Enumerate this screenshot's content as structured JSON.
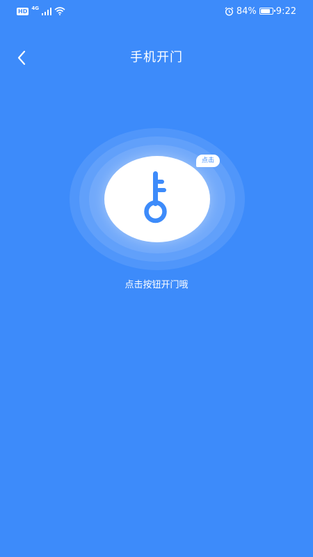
{
  "status_bar": {
    "hd": "HD",
    "network": "4G",
    "battery_percent": "84%",
    "battery_level": 0.84,
    "time": "9:22",
    "icons": {
      "signal": "signal-icon",
      "wifi": "wifi-icon",
      "alarm": "alarm-icon",
      "battery": "battery-icon"
    }
  },
  "header": {
    "title": "手机开门",
    "back_icon": "chevron-left-icon"
  },
  "key_button": {
    "icon": "key-icon",
    "tap_label": "点击"
  },
  "hint": "点击按钮开门哦",
  "colors": {
    "background": "#3d8bfa",
    "key": "#3d8bfa",
    "foreground": "#ffffff"
  }
}
